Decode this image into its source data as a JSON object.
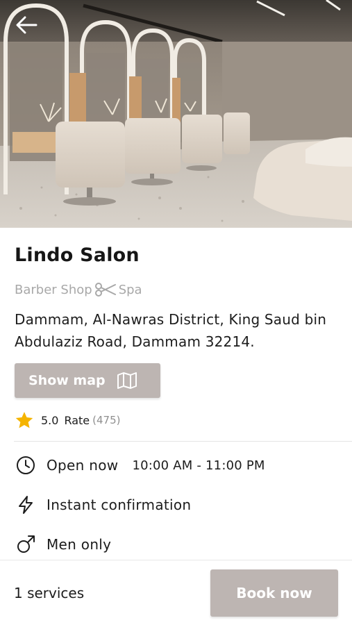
{
  "salon": {
    "name": "Lindo Salon",
    "category_1": "Barber Shop",
    "category_2": "Spa",
    "address": "Dammam, Al-Nawras District, King Saud bin Abdulaziz Road, Dammam 32214."
  },
  "actions": {
    "show_map_label": "Show map",
    "book_now_label": "Book now",
    "back_icon": "arrow-left-icon"
  },
  "rating": {
    "value": "5.0",
    "label": "Rate",
    "count": "(475)"
  },
  "info": {
    "open_status": "Open now",
    "hours": "10:00 AM - 11:00 PM",
    "confirmation": "Instant confirmation",
    "gender": "Men only"
  },
  "footer": {
    "services_count": "1 services"
  },
  "colors": {
    "button": "#bdb5b2",
    "star": "#f5b400",
    "muted_text": "#a8a8a8"
  }
}
